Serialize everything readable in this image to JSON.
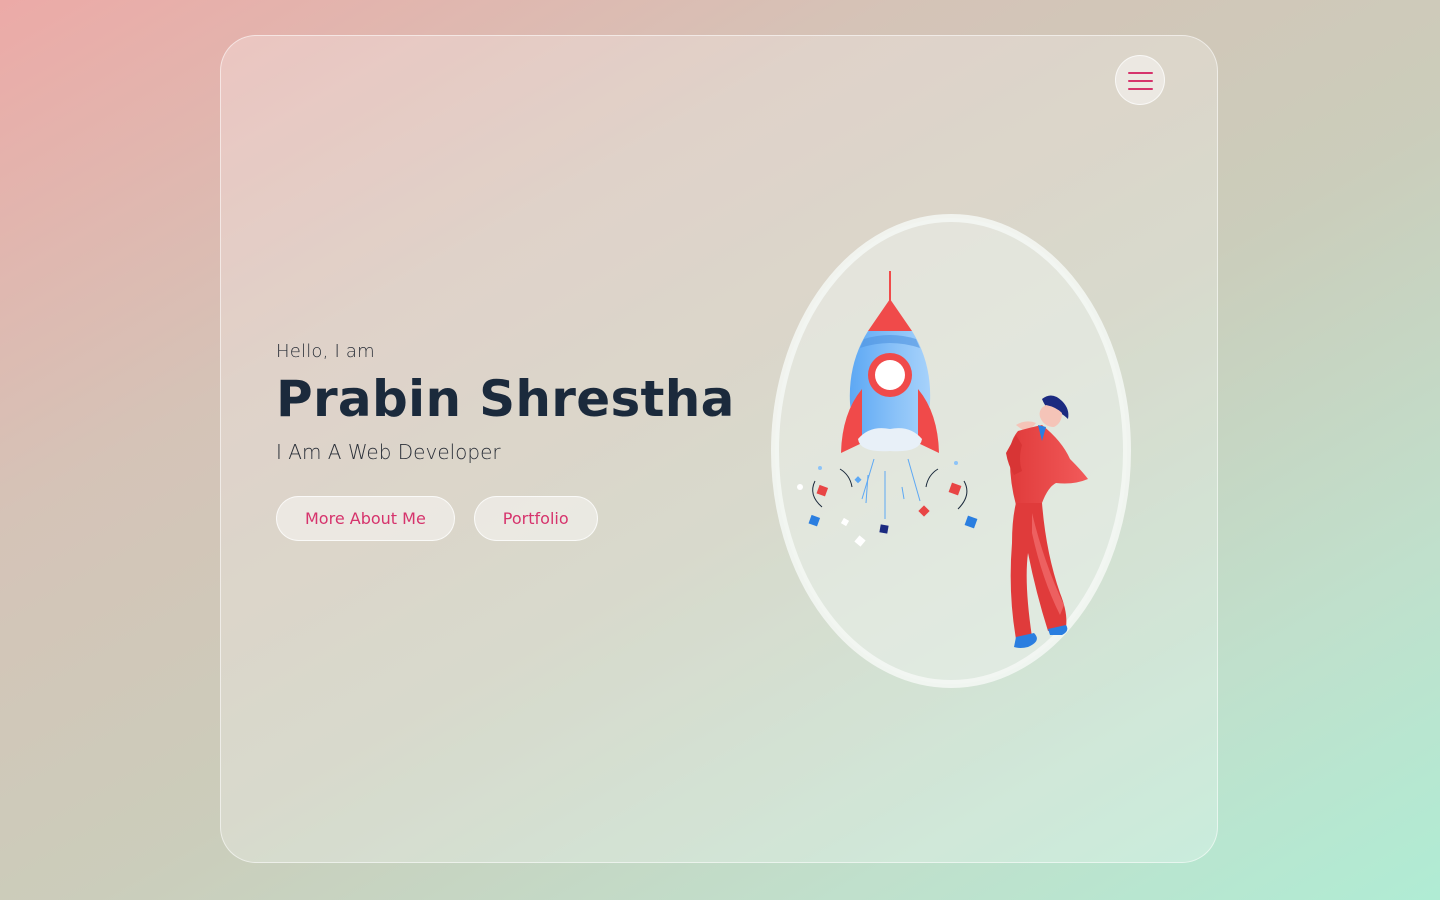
{
  "header": {
    "menu_icon": "hamburger-menu-icon"
  },
  "hero": {
    "greeting": "Hello, I am",
    "name": "Prabin Shrestha",
    "role": "I Am A Web Developer",
    "buttons": {
      "about_label": "More About Me",
      "portfolio_label": "Portfolio"
    }
  },
  "illustration": {
    "subject": "rocket-launch-with-man-illustration"
  },
  "colors": {
    "accent": "#d6336c",
    "heading": "#1b2a3c",
    "rocket_red": "#f04a4a",
    "rocket_blue": "#7ab8f5"
  }
}
